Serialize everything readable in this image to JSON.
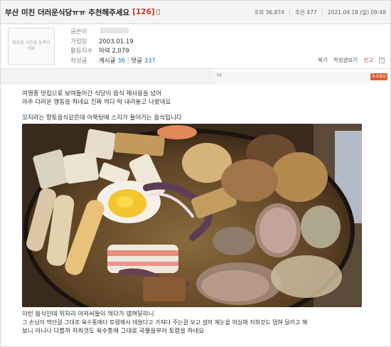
{
  "post": {
    "title": "부산 미친 더러운식당ㅠㅠ 추천해주세요",
    "reply_count": "[126]",
    "views": "조회 36,874",
    "likes": "추천 477",
    "date": "2021.04.18 (일) 09:48"
  },
  "author": {
    "avatar_text": "회원필 사진을 등록하세요",
    "labels": {
      "posts": "글쓴이",
      "joined": "가입일",
      "activity": "활동지수",
      "written": "작성글"
    },
    "joined": "2003.01.19",
    "activity": "마력 2,079",
    "posts_label": "게시글",
    "posts_count": "36",
    "comments_label": "댓글",
    "comments_count": "337",
    "divider": "|"
  },
  "actions": {
    "bookmark": "묵기",
    "author_posts": "작성글보기",
    "report": "신고",
    "close": "×"
  },
  "content": {
    "url_prefix": "ht",
    "copy_button": "주소복사",
    "paragraphs": [
      "여행중 맛집으로 보여들어간 식당이 음식 재사용을 넘어",
      "아주 더러운 행동을 하네요 진짜 먹다 탁 내려놓고 나왔네요",
      "꼬지라는 향토음식같은데 어묵탕에 스지가 들어가는 음식입니다",
      "이런 음식인데 뒤자리 아저씨들이 먹다가 뎁혀달라니",
      "그 손님이 먹던걸 그대로 육수통에다 토렴해서 데웠다고 가져다 주는걸 보고 설마 제눈을 의심해 저희것도 뎁혀 달라고 해",
      "보니 아니나 다를까 저희것도 육수통에 그대로 국물을부어 토렴을 하네요"
    ]
  },
  "colors": {
    "accent": "#c0392b",
    "link": "#1a6fc4",
    "copy_button": "#e05b32"
  }
}
